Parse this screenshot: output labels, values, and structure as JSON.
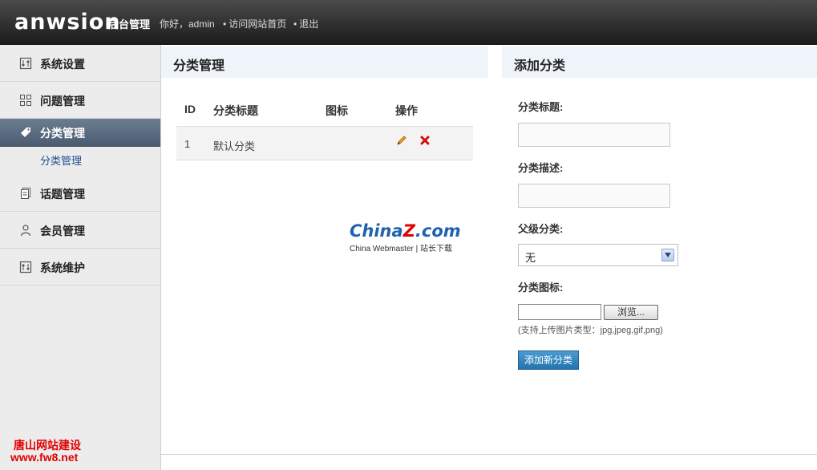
{
  "header": {
    "logo": "anwsion",
    "admin_title": "后台管理",
    "greeting": "你好，admin",
    "links": [
      "访问网站首页",
      "退出"
    ]
  },
  "sidebar": {
    "items": [
      {
        "label": "系统设置",
        "icon": "settings-icon"
      },
      {
        "label": "问题管理",
        "icon": "grid-icon"
      },
      {
        "label": "分类管理",
        "icon": "tag-icon",
        "active": true
      },
      {
        "label": "话题管理",
        "icon": "documents-icon"
      },
      {
        "label": "会员管理",
        "icon": "user-icon"
      },
      {
        "label": "系统维护",
        "icon": "maintenance-icon"
      }
    ],
    "sub_item": "分类管理",
    "watermark": [
      "唐山网站建设",
      "www.fw8.net"
    ]
  },
  "list_panel": {
    "title": "分类管理",
    "columns": [
      "ID",
      "分类标题",
      "图标",
      "操作"
    ],
    "rows": [
      {
        "id": "1",
        "title": "默认分类",
        "icon": ""
      }
    ]
  },
  "brand_watermark": {
    "main": "China",
    "z": "Z",
    "domain": ".com",
    "sub": "China Webmaster | 站长下载"
  },
  "form_panel": {
    "title": "添加分类",
    "title_label": "分类标题:",
    "title_value": "",
    "desc_label": "分类描述:",
    "desc_value": "",
    "parent_label": "父级分类:",
    "parent_selected": "无",
    "icon_label": "分类图标:",
    "browse_label": "浏览...",
    "hint": "(支持上传图片类型：jpg,jpeg,gif,png)",
    "submit_label": "添加新分类"
  },
  "colors": {
    "active_nav": "#5b6b80",
    "submit": "#2a80bd",
    "link": "#1d4f91"
  }
}
